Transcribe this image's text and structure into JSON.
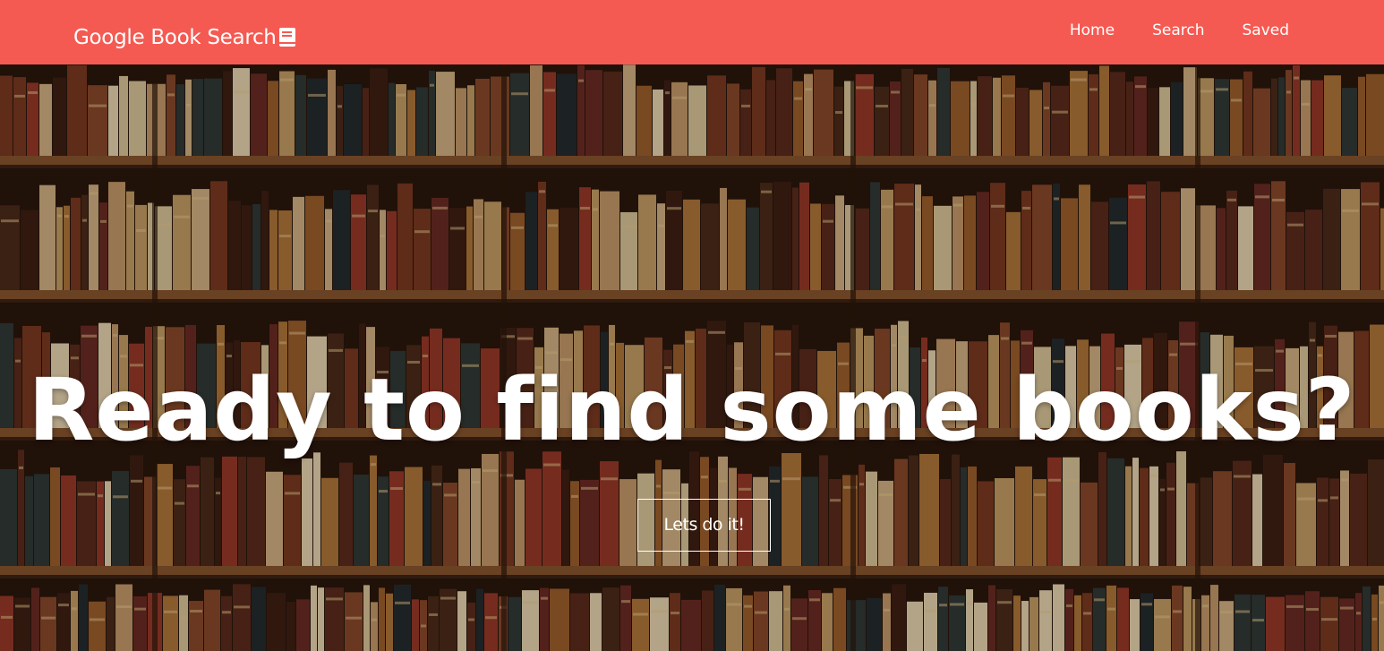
{
  "navbar": {
    "brand": "Google Book Search",
    "brand_icon": "book-icon",
    "links": [
      "Home",
      "Search",
      "Saved"
    ],
    "color": "#f55a52"
  },
  "hero": {
    "title": "Ready to find some books?",
    "cta_label": "Lets do it!",
    "background": "bookshelf-photo"
  }
}
